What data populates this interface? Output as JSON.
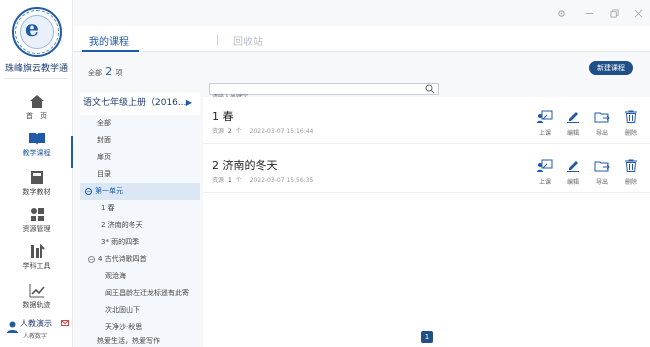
{
  "sidebar": {
    "brand_name": "珠峰旗云教学通",
    "items": [
      {
        "label": "首　页",
        "icon": "home-icon"
      },
      {
        "label": "教学课程",
        "icon": "book-icon"
      },
      {
        "label": "数字教材",
        "icon": "textbook-icon"
      },
      {
        "label": "资源管理",
        "icon": "resources-icon"
      },
      {
        "label": "学科工具",
        "icon": "tools-icon"
      },
      {
        "label": "数据轨迹",
        "icon": "chart-icon"
      }
    ],
    "user": {
      "name": "人教演示",
      "subtitle": "人教数字"
    }
  },
  "header": {
    "tabs": [
      {
        "label": "我的课程",
        "active": true
      },
      {
        "label": "回收站",
        "active": false
      }
    ]
  },
  "toolbar": {
    "total_prefix": "全部",
    "total_count": "2",
    "total_suffix": "项",
    "new_button_label": "新建课程",
    "search_placeholder": "请输入关键字"
  },
  "tree": {
    "header": "语文七年级上册（2016...",
    "items": [
      {
        "label": "全部",
        "indent": 1
      },
      {
        "label": "封面",
        "indent": 1
      },
      {
        "label": "扉页",
        "indent": 1
      },
      {
        "label": "目录",
        "indent": 1
      },
      {
        "label": "第一单元",
        "indent": 0,
        "expanded": true,
        "selected": true
      },
      {
        "label": "1 春",
        "indent": 2
      },
      {
        "label": "2 济南的冬天",
        "indent": 2
      },
      {
        "label": "3* 雨的四季",
        "indent": 2
      },
      {
        "label": "4 古代诗歌四首",
        "indent": 1,
        "expanded": true
      },
      {
        "label": "观沧海",
        "indent": 2
      },
      {
        "label": "闻王昌龄左迁龙标遥有此寄",
        "indent": 2
      },
      {
        "label": "次北固山下",
        "indent": 2
      },
      {
        "label": "天净沙·秋思",
        "indent": 2
      },
      {
        "label": "热爱生活，热爱写作",
        "indent": 1
      }
    ]
  },
  "courses": [
    {
      "title": "1 春",
      "meta_prefix": "资源",
      "count": "2",
      "meta_unit": "个",
      "date": "2022-03-07 15:16:44"
    },
    {
      "title": "2 济南的冬天",
      "meta_prefix": "资源",
      "count": "1",
      "meta_unit": "个",
      "date": "2022-03-07 15:56:35"
    }
  ],
  "actions": [
    {
      "label": "上课",
      "icon": "teach-icon"
    },
    {
      "label": "编辑",
      "icon": "edit-icon"
    },
    {
      "label": "导出",
      "icon": "export-icon"
    },
    {
      "label": "删除",
      "icon": "delete-icon"
    }
  ],
  "pagination": {
    "current": "1"
  },
  "colors": {
    "accent": "#1e5aa8",
    "button": "#1f4f86"
  }
}
